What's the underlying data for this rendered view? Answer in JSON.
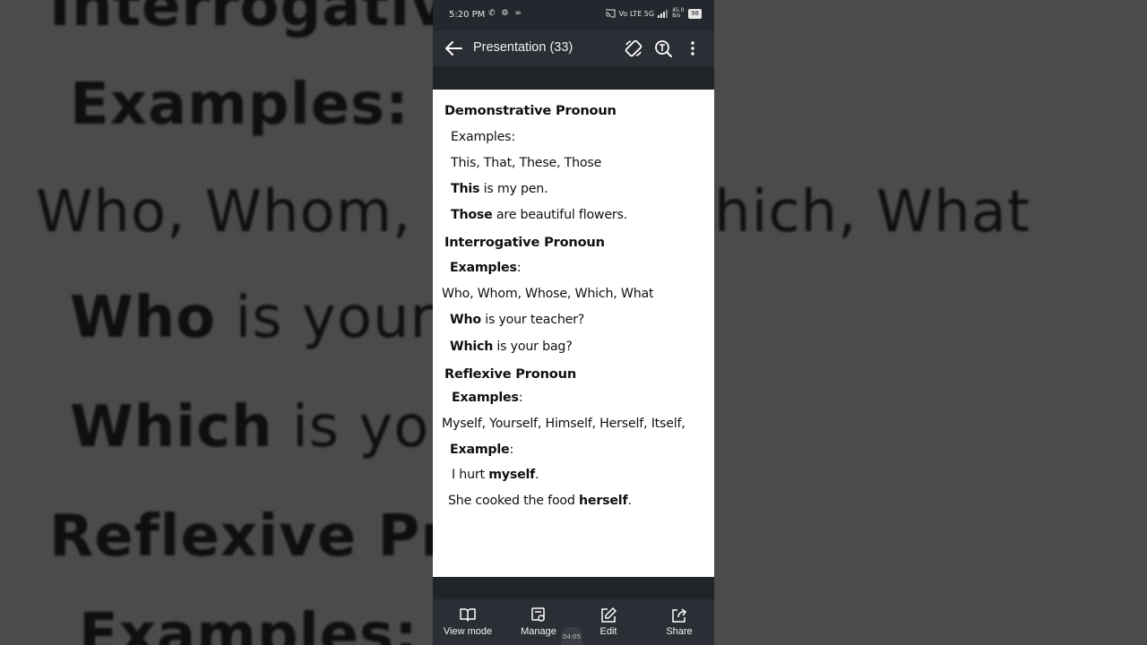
{
  "background": {
    "lines": [
      {
        "pre": "Interrogative",
        "bold": "",
        "post": ""
      },
      {
        "pre": "Examples:",
        "bold": "",
        "post": ""
      },
      {
        "pre": "Who, Whom, W",
        "bold": "",
        "post": ""
      },
      {
        "pre": "hich, What",
        "bold": "",
        "post": ""
      },
      {
        "pre": "",
        "bold": "Who",
        "post": " is your t"
      },
      {
        "pre": "",
        "bold": "Which",
        "post": " is you"
      },
      {
        "pre": "",
        "bold": "Reflexive Pro",
        "post": ""
      },
      {
        "pre": "",
        "bold": "Examples:",
        "post": ""
      }
    ]
  },
  "status_bar": {
    "time": "5:20 PM",
    "app_icons": "✆ ⚙ ∞",
    "signal": "Vo LTE 5G",
    "speed": "45.0 B/s",
    "battery": "98"
  },
  "app_bar": {
    "title": "Presentation (33)",
    "back_icon": "arrow-left-icon",
    "rotate_icon": "screen-rotate-icon",
    "text_icon": "text-search-icon",
    "more_icon": "more-vertical-icon"
  },
  "slide": {
    "lines": [
      {
        "pre": "",
        "bold": "Demonstrative Pronoun",
        "post": ""
      },
      {
        "pre": "Examples:",
        "bold": "",
        "post": ""
      },
      {
        "pre": "This, That, These, Those",
        "bold": "",
        "post": ""
      },
      {
        "pre": "",
        "bold": "This",
        "post": " is my pen."
      },
      {
        "pre": "",
        "bold": "Those",
        "post": " are beautiful flowers."
      },
      {
        "pre": "",
        "bold": "Interrogative Pronoun",
        "post": ""
      },
      {
        "pre": "",
        "bold": "Examples",
        "post": ":"
      },
      {
        "pre": "Who, Whom, Whose, Which, What",
        "bold": "",
        "post": ""
      },
      {
        "pre": "",
        "bold": "Who",
        "post": " is your teacher?"
      },
      {
        "pre": "",
        "bold": "Which",
        "post": " is your bag?"
      },
      {
        "pre": "",
        "bold": "Reflexive Pronoun",
        "post": ""
      },
      {
        "pre": "",
        "bold": "Examples",
        "post": ":"
      },
      {
        "pre": "Myself, Yourself, Himself, Herself, Itself,",
        "bold": "",
        "post": ""
      },
      {
        "pre": "",
        "bold": "Example",
        "post": ":"
      },
      {
        "pre": "I hurt ",
        "bold": "myself",
        "post": "."
      },
      {
        "pre": "She cooked the food ",
        "bold": "herself",
        "post": "."
      }
    ]
  },
  "bottom_bar": {
    "items": [
      {
        "label": "View mode",
        "icon": "book-open-icon"
      },
      {
        "label": "Manage",
        "icon": "manage-slides-icon"
      },
      {
        "label": "Edit",
        "icon": "edit-icon"
      },
      {
        "label": "Share",
        "icon": "share-icon"
      }
    ],
    "timestamp": "04:05"
  }
}
